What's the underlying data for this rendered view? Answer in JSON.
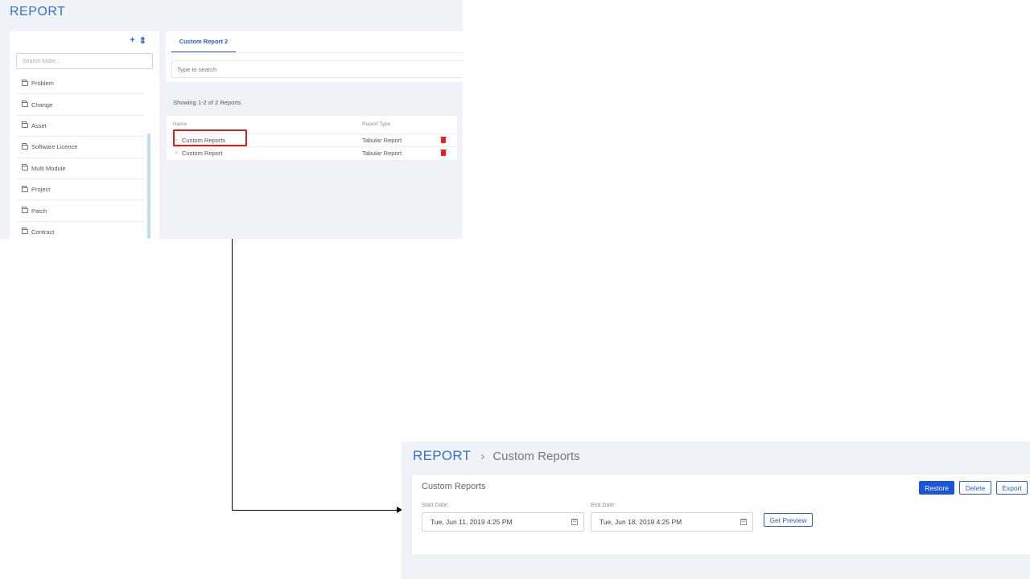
{
  "list_view": {
    "app_title": "REPORT",
    "folder_panel": {
      "tools": {
        "add": "+",
        "sort": "⇕"
      },
      "search_placeholder": "Search folder...",
      "items": [
        "Problem",
        "Change",
        "Asset",
        "Software Licence",
        "Multi Module",
        "Project",
        "Patch",
        "Contract"
      ]
    },
    "tabs": [
      {
        "label": "Custom Report 2"
      }
    ],
    "report_search_placeholder": "Type to search",
    "showing_text": "Showing 1-2 of 2 Reports",
    "table": {
      "columns": {
        "name": "Name",
        "type": "Report Type"
      },
      "rows": [
        {
          "name": "Custom Reports",
          "type": "Tabular Report"
        },
        {
          "name": "Custom Report",
          "type": "Tabular Report"
        }
      ]
    }
  },
  "detail_view": {
    "breadcrumb": {
      "root": "REPORT",
      "separator": "›",
      "current": "Custom Reports"
    },
    "title": "Custom Reports",
    "buttons": {
      "restore": "Restore",
      "delete": "Delete",
      "export": "Export",
      "preview": "Get Preview"
    },
    "start_date": {
      "label": "Start Date:",
      "value": "Tue, Jun 11, 2019 4:25 PM"
    },
    "end_date": {
      "label": "End Date:",
      "value": "Tue, Jun 18, 2019 4:25 PM"
    }
  },
  "colors": {
    "accent": "#2a5bd7",
    "danger": "#e02424",
    "highlight": "#d42020",
    "background": "#eff3f7"
  }
}
